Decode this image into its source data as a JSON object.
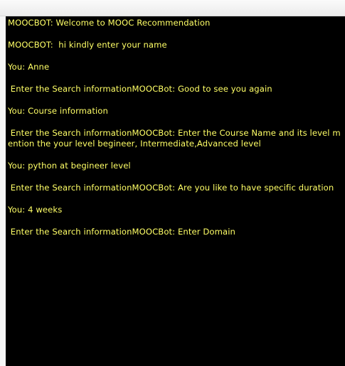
{
  "theme": {
    "background": "#000000",
    "text_color": "#ffff66"
  },
  "chat": {
    "messages": [
      "MOOCBOT: Welcome to MOOC Recommendation",
      "MOOCBOT:  hi kindly enter your name",
      "You: Anne",
      " Enter the Search informationMOOCBot: Good to see you again",
      "You: Course information",
      " Enter the Search informationMOOCBot: Enter the Course Name and its level mention the your level begineer, Intermediate,Advanced level",
      "You: python at begineer level",
      " Enter the Search informationMOOCBot: Are you like to have specific duration",
      "You: 4 weeks",
      " Enter the Search informationMOOCBot: Enter Domain"
    ]
  }
}
